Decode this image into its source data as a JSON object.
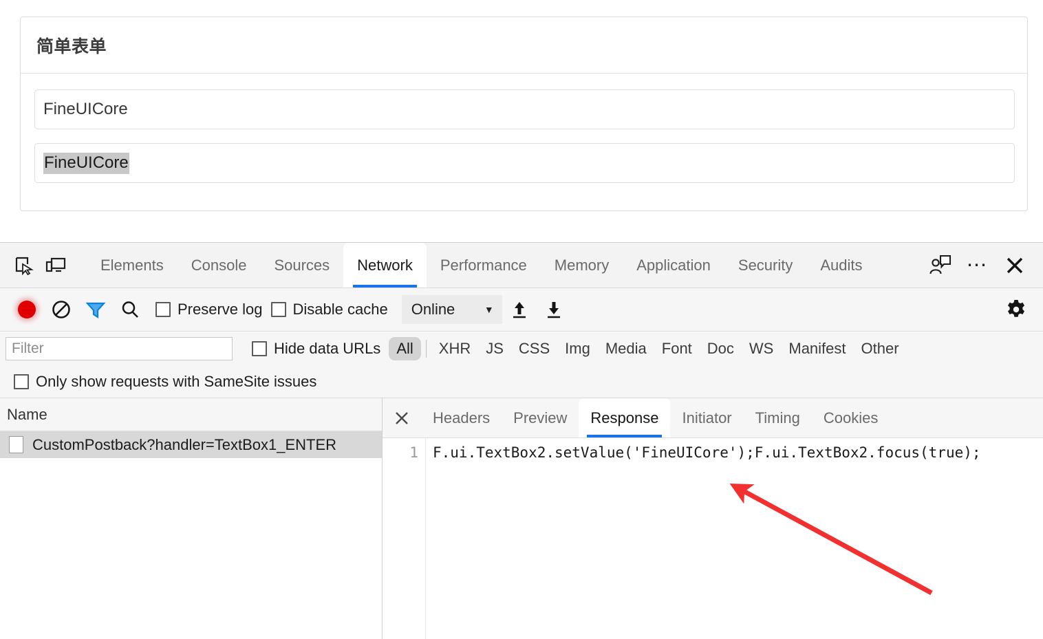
{
  "app": {
    "form_card": {
      "title": "简单表单",
      "textbox1_value": "FineUICore",
      "textbox2_value": "FineUICore"
    }
  },
  "devtools": {
    "tabs": [
      {
        "label": "Elements",
        "active": false
      },
      {
        "label": "Console",
        "active": false
      },
      {
        "label": "Sources",
        "active": false
      },
      {
        "label": "Network",
        "active": true
      },
      {
        "label": "Performance",
        "active": false
      },
      {
        "label": "Memory",
        "active": false
      },
      {
        "label": "Application",
        "active": false
      },
      {
        "label": "Security",
        "active": false
      },
      {
        "label": "Audits",
        "active": false
      }
    ],
    "tabbar_icons": [
      "inspect-element-icon",
      "device-toolbar-icon"
    ],
    "tabbar_right_icons": [
      "feedback-icon",
      "more-options-icon",
      "close-devtools-icon"
    ],
    "toolbar": {
      "record_icon": "record-icon",
      "clear_icon": "clear-icon",
      "filter_icon": "filter-icon",
      "search_icon": "search-icon",
      "preserve_log_label": "Preserve log",
      "preserve_log_checked": false,
      "disable_cache_label": "Disable cache",
      "disable_cache_checked": false,
      "throttle_value": "Online",
      "import_har_icon": "upload-icon",
      "export_har_icon": "download-icon",
      "settings_icon": "gear-icon"
    },
    "filter_bar": {
      "filter_placeholder": "Filter",
      "filter_value": "",
      "hide_data_urls_label": "Hide data URLs",
      "hide_data_urls_checked": false,
      "types": [
        "All",
        "XHR",
        "JS",
        "CSS",
        "Img",
        "Media",
        "Font",
        "Doc",
        "WS",
        "Manifest",
        "Other"
      ],
      "active_type": "All"
    },
    "samesite": {
      "label": "Only show requests with SameSite issues",
      "checked": false
    },
    "requests": {
      "column_header": "Name",
      "rows": [
        {
          "name": "CustomPostback?handler=TextBox1_ENTER",
          "selected": true
        }
      ]
    },
    "detail": {
      "close_icon": "close-icon",
      "tabs": [
        {
          "label": "Headers",
          "active": false
        },
        {
          "label": "Preview",
          "active": false
        },
        {
          "label": "Response",
          "active": true
        },
        {
          "label": "Initiator",
          "active": false
        },
        {
          "label": "Timing",
          "active": false
        },
        {
          "label": "Cookies",
          "active": false
        }
      ],
      "response": {
        "line_number": "1",
        "code": "F.ui.TextBox2.setValue('FineUICore');F.ui.TextBox2.focus(true);"
      }
    }
  },
  "annotation": {
    "arrow_color": "#f23030",
    "arrow_name": "red-pointer-arrow"
  },
  "colors": {
    "accent": "#1a73e8",
    "record_red": "#e00000",
    "filter_blue": "#1a9bf0",
    "selection_gray": "#c8c8c8",
    "row_selected": "#d8d8d8",
    "arrow_red": "#f23030"
  }
}
